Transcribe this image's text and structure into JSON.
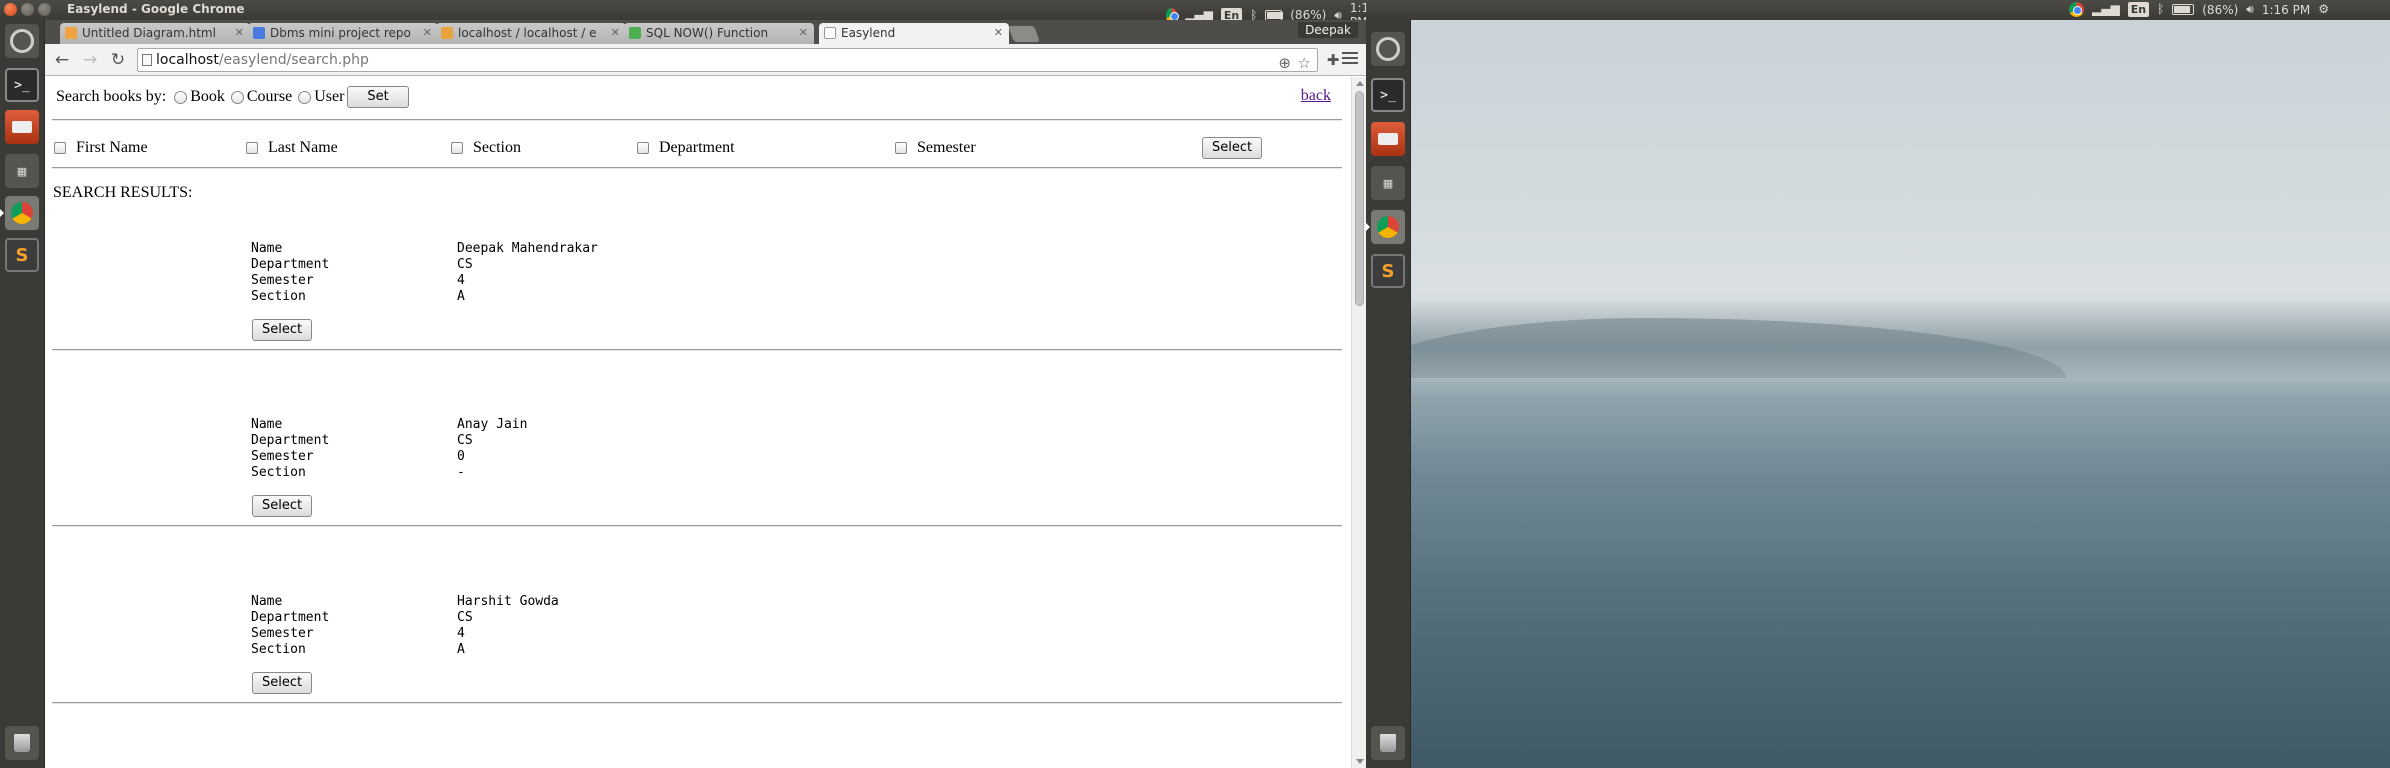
{
  "left_topbar": {
    "window_title": "Easylend - Google Chrome",
    "battery": "(86%)",
    "time": "1:16 PM",
    "lang": "En"
  },
  "right_topbar": {
    "battery": "(86%)",
    "time": "1:16 PM",
    "lang": "En"
  },
  "browser": {
    "tabs": [
      {
        "title": "Untitled Diagram.html",
        "favicon_color": "#f1a340"
      },
      {
        "title": "Dbms mini project repo",
        "favicon_color": "#4a7be0"
      },
      {
        "title": "localhost / localhost / e",
        "favicon_color": "#e8a33c"
      },
      {
        "title": "SQL NOW() Function",
        "favicon_color": "#4caf50"
      },
      {
        "title": "Easylend",
        "favicon_color": "#dddddd"
      }
    ],
    "profile": "Deepak",
    "url_host": "localhost",
    "url_path": "/easylend/search.php"
  },
  "page": {
    "search_by_label": "Search books by:",
    "search_options": [
      "Book",
      "Course",
      "User"
    ],
    "set_label": "Set",
    "back_label": "back",
    "filters": [
      "First Name",
      "Last Name",
      "Section",
      "Department",
      "Semester"
    ],
    "select_label": "Select",
    "results_heading": "SEARCH RESULTS:",
    "field_labels": {
      "name": "Name",
      "department": "Department",
      "semester": "Semester",
      "section": "Section"
    },
    "results": [
      {
        "name": "Deepak Mahendrakar",
        "department": "CS",
        "semester": "4",
        "section": "A"
      },
      {
        "name": "Anay Jain",
        "department": "CS",
        "semester": "0",
        "section": "-"
      },
      {
        "name": "Harshit Gowda",
        "department": "CS",
        "semester": "4",
        "section": "A"
      }
    ]
  }
}
